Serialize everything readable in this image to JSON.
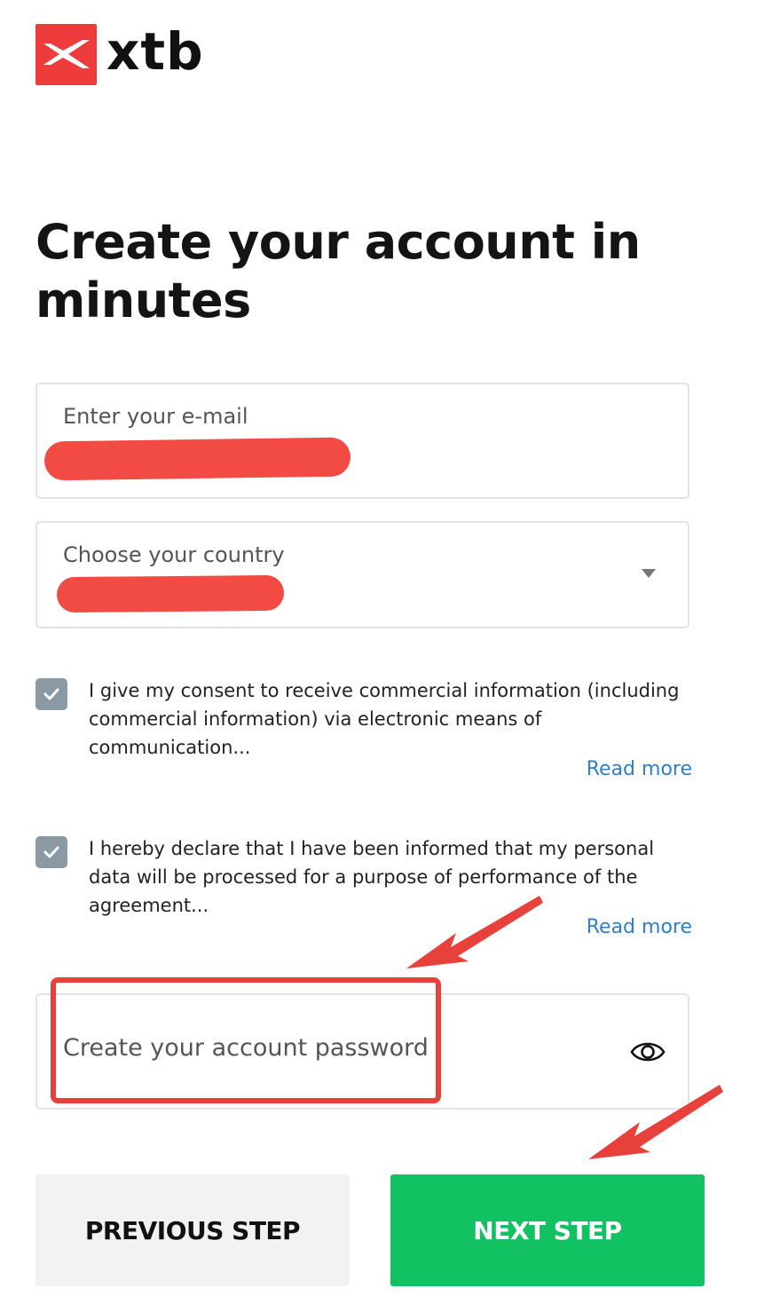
{
  "brand": {
    "name": "xtb",
    "accent_color": "#ee3b3b"
  },
  "page": {
    "title": "Create your account in minutes"
  },
  "form": {
    "email": {
      "label": "Enter your e-mail",
      "value_redacted": true
    },
    "country": {
      "label": "Choose your country",
      "value_redacted": true,
      "icon": "dropdown-caret-icon"
    },
    "consents": [
      {
        "checked": true,
        "text": "I give my consent to receive commercial information (including commercial information) via electronic means of communication...",
        "link": "Read more"
      },
      {
        "checked": true,
        "text": "I hereby declare that I have been informed that my personal data will be processed for a purpose of performance of the agreement...",
        "link": "Read more"
      }
    ],
    "password": {
      "label": "Create your account password",
      "icon": "eye-icon"
    }
  },
  "buttons": {
    "previous": "PREVIOUS STEP",
    "next": "NEXT STEP"
  },
  "colors": {
    "link": "#2d7fcb",
    "primary_button": "#12c262",
    "secondary_button": "#f2f2f2",
    "checkbox": "#8a99a3",
    "annotation": "#e8403a"
  }
}
